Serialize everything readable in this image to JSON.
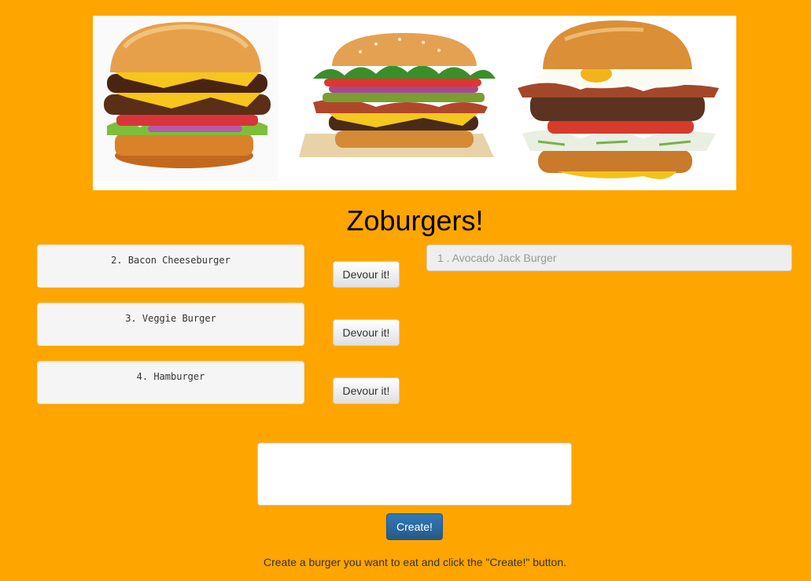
{
  "header": {
    "title": "Zoburgers!"
  },
  "banner": {
    "images": [
      "burger-1-image",
      "burger-2-image",
      "burger-3-image"
    ]
  },
  "burgers": [
    {
      "label": "2. Bacon Cheeseburger",
      "button": "Devour it!"
    },
    {
      "label": "3. Veggie Burger",
      "button": "Devour it!"
    },
    {
      "label": "4. Hamburger",
      "button": "Devour it!"
    }
  ],
  "devoured": {
    "items": [
      "1 . Avocado Jack Burger"
    ]
  },
  "form": {
    "input_value": "",
    "create_label": "Create!",
    "help_text": "Create a burger you want to eat and click the \"Create!\" button."
  },
  "colors": {
    "background": "#FFA500",
    "primary_button": "#286090"
  }
}
